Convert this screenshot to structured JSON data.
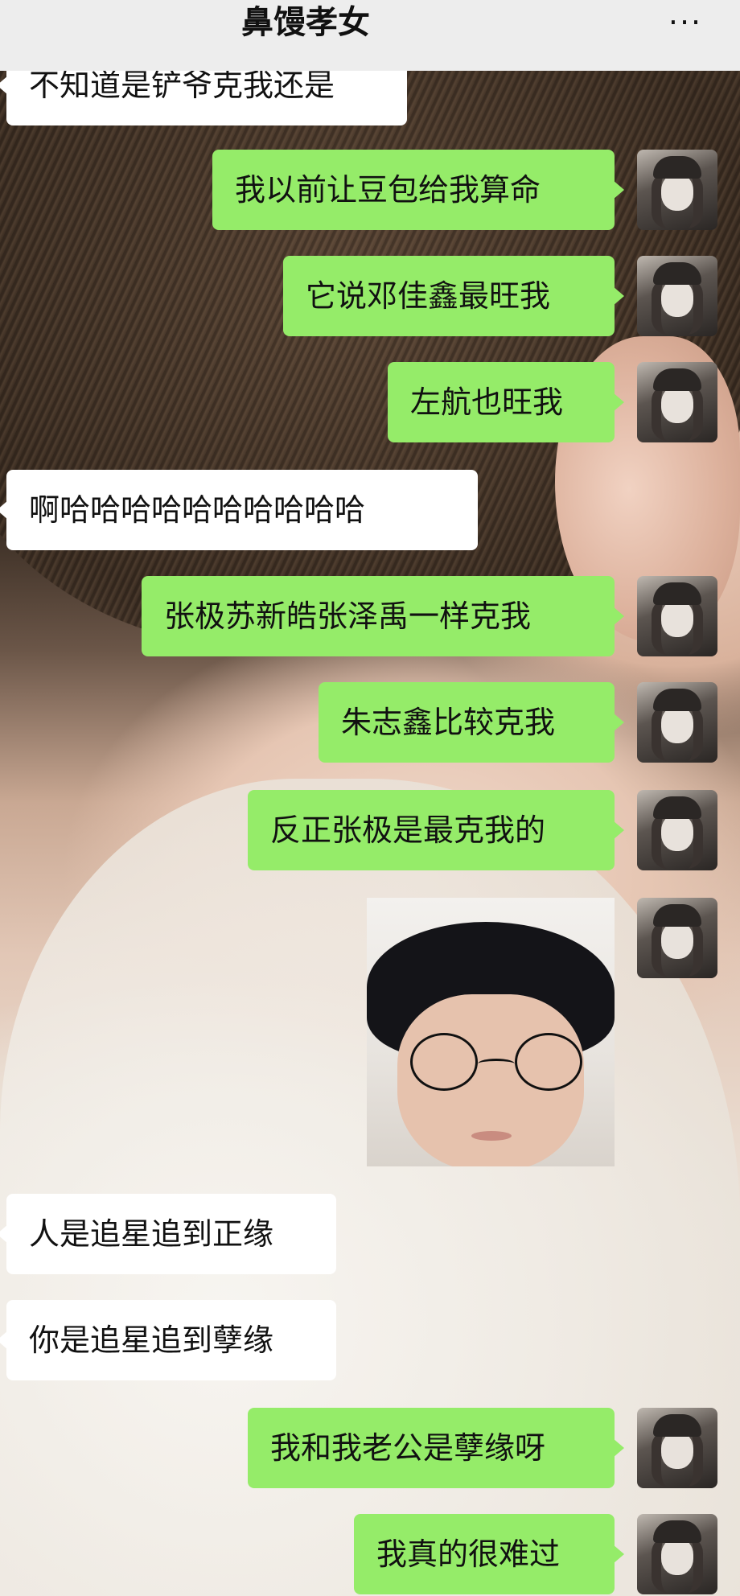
{
  "header": {
    "title": "鼻馒孝女",
    "more_label": "···"
  },
  "messages": [
    {
      "side": "in",
      "text": "不知道是铲爷克我还是"
    },
    {
      "side": "out",
      "text": "我以前让豆包给我算命"
    },
    {
      "side": "out",
      "text": "它说邓佳鑫最旺我"
    },
    {
      "side": "out",
      "text": "左航也旺我"
    },
    {
      "side": "in",
      "text": "啊哈哈哈哈哈哈哈哈哈哈"
    },
    {
      "side": "out",
      "text": "张极苏新皓张泽禹一样克我"
    },
    {
      "side": "out",
      "text": "朱志鑫比较克我"
    },
    {
      "side": "out",
      "text": "反正张极是最克我的"
    },
    {
      "side": "out",
      "type": "image",
      "image": "sticker-photo"
    },
    {
      "side": "in",
      "text": "人是追星追到正缘"
    },
    {
      "side": "in",
      "text": "你是追星追到孽缘"
    },
    {
      "side": "out",
      "text": "我和我老公是孽缘呀"
    },
    {
      "side": "out",
      "text": "我真的很难过"
    }
  ],
  "colors": {
    "outgoing_bubble": "#95ec69",
    "incoming_bubble": "#ffffff",
    "header_bg": "#ededed"
  },
  "icons": {
    "more": "more-dots-icon"
  }
}
